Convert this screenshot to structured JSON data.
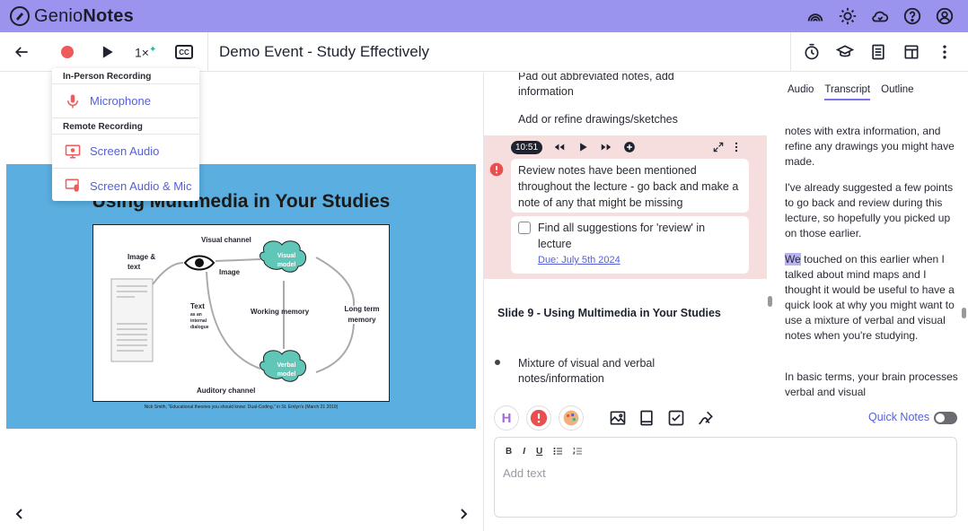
{
  "brand": {
    "prefix": "Genio",
    "suffix": "Notes"
  },
  "toolbar": {
    "speed": "1×",
    "cc": "CC",
    "event_title": "Demo Event - Study Effectively"
  },
  "dropdown": {
    "section_in_person": "In-Person Recording",
    "microphone": "Microphone",
    "section_remote": "Remote Recording",
    "screen_audio": "Screen Audio",
    "screen_audio_mic": "Screen Audio & Mic"
  },
  "slide": {
    "title": "Using Multimedia in Your Studies",
    "visual_channel": "Visual channel",
    "image_text": "Image & text",
    "image": "Image",
    "visual_model": "Visual model",
    "text": "Text",
    "text_sub": "as an internal dialogue",
    "working_memory": "Working memory",
    "long_term_memory": "Long term memory",
    "verbal_model": "Verbal model",
    "auditory_channel": "Auditory channel",
    "caption": "Nick Smith, \"Educational theories you should know: Dual-Coding,\" in St. Emlyn's (March 21 2019)"
  },
  "notes": {
    "line1": "Pad out abbreviated notes, add information",
    "line2": "Add or refine drawings/sketches",
    "player_time": "10:51",
    "review_text": "Review notes have been mentioned throughout the lecture - go back and make a note of any that might be missing",
    "task_text": "Find all suggestions for 'review' in lecture",
    "due": "Due: July 5th 2024",
    "slide_heading": "Slide 9 - Using Multimedia in Your Studies",
    "bullet1": "Mixture of visual and verbal notes/information"
  },
  "editor": {
    "quick_notes": "Quick Notes",
    "placeholder": "Add text",
    "fmt_bold": "B",
    "fmt_italic": "I",
    "fmt_underline": "U",
    "heading_btn": "H"
  },
  "transcript": {
    "tabs": [
      "Audio",
      "Transcript",
      "Outline"
    ],
    "para1": "notes with extra information, and refine any drawings you might have made.",
    "para2": "I've already suggested a few points to go back and review during this lecture, so hopefully you picked up on those earlier.",
    "para3_hl": "We",
    "para3": " touched on this earlier when I talked about mind maps and I thought it would be useful to have a quick look at why you might want to use a mixture of verbal and visual notes when you're studying.",
    "para4": "In basic terms, your brain processes verbal and visual"
  },
  "colors": {
    "brand": "#9a94ee",
    "accent": "#5560d8",
    "record": "#ef5b5b",
    "slide_bg": "#5aaee0"
  }
}
